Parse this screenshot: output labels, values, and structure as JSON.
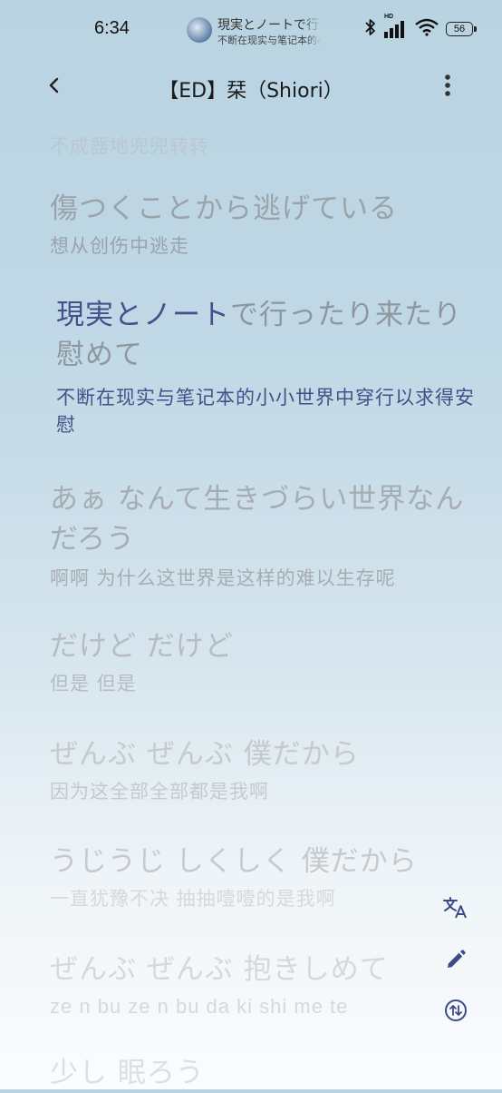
{
  "status_bar": {
    "time": "6:34",
    "notification_title": "現実とノートで行ったり来たり慰めて",
    "notification_subtitle": "不断在现实与笔记本的小小世界中穿行以求得安慰",
    "network_label": "HD",
    "battery": "56"
  },
  "app_bar": {
    "title": "【ED】栞（Shiori）"
  },
  "lyrics": [
    {
      "jp": "",
      "tr": "不成器地兜兜转转"
    },
    {
      "jp": "傷つくことから逃げている",
      "tr": "想从创伤中逃走"
    },
    {
      "jp_sung": "現実とノート",
      "jp_rest": "で行ったり来たり 慰めて",
      "tr": "不断在现实与笔记本的小小世界中穿行以求得安慰"
    },
    {
      "jp": "あぁ なんて生きづらい世界なんだろう",
      "tr": "啊啊 为什么这世界是这样的难以生存呢"
    },
    {
      "jp": "だけど だけど",
      "tr": "但是 但是"
    },
    {
      "jp": "ぜんぶ ぜんぶ 僕だから",
      "tr": "因为这全部全部都是我啊"
    },
    {
      "jp": "うじうじ しくしく 僕だから",
      "tr": "一直犹豫不决 抽抽噎噎的是我啊"
    },
    {
      "jp": "ぜんぶ ぜんぶ 抱きしめて",
      "romaji": "ze n bu ze n bu da ki shi me te"
    },
    {
      "jp": "少し 眠ろう"
    }
  ],
  "actions": {
    "translate_icon": "translate-icon",
    "edit_icon": "edit-icon",
    "swap_icon": "swap-vertical-icon"
  }
}
